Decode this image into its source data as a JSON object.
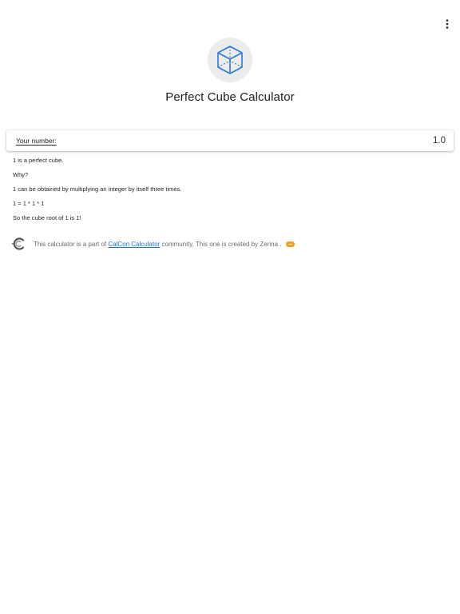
{
  "header": {
    "menu_icon": "more-vert-icon"
  },
  "hero": {
    "icon": "cube-icon",
    "title": "Perfect Cube Calculator"
  },
  "input": {
    "label": "Your number:",
    "value": "1.0"
  },
  "results": {
    "lines": [
      "1 is a perfect cube.",
      "Why?",
      "1 can be obtained by multiplying an integer by itself three times.",
      "1 = 1 * 1 * 1",
      "So the cube root of 1 is 1!"
    ]
  },
  "footer": {
    "logo_icon": "calcon-logo-icon",
    "text_before": "This calculator is a part of ",
    "link_text": "CalCon Calculator",
    "text_after": " community. This one is created by Zerina .",
    "badge_icon": "author-badge-icon"
  },
  "colors": {
    "accent": "#1a73c9",
    "icon_blue": "#2979d9",
    "badge": "#f0a020"
  }
}
